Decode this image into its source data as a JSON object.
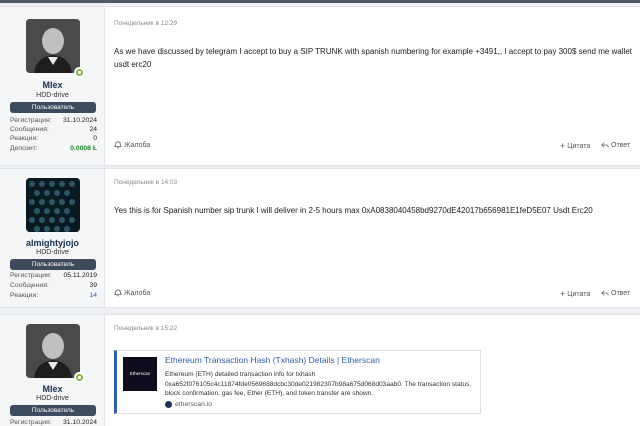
{
  "posts": [
    {
      "user": {
        "name": "Mlex",
        "title": "HDD-drive",
        "badge": "Пользователь",
        "stats": [
          {
            "label": "Регистрация:",
            "value": "31.10.2024"
          },
          {
            "label": "Сообщения:",
            "value": "24"
          },
          {
            "label": "Реакции:",
            "value": "0"
          },
          {
            "label": "Депозит:",
            "value": "0.0008 Ł"
          }
        ]
      },
      "date": "Понедельник в 12:29",
      "message": "As we have discussed by telegram I accept to buy a SIP TRUNK with spanish numbering for example +3491,, I accept to pay 300$ send me wallet usdt erc20",
      "actions": {
        "report": "Жалоба",
        "quote": "Цитата",
        "reply": "Ответ"
      }
    },
    {
      "user": {
        "name": "almightyjojo",
        "title": "HDD-drive",
        "badge": "Пользователь",
        "stats": [
          {
            "label": "Регистрация:",
            "value": "05.11.2019"
          },
          {
            "label": "Сообщения:",
            "value": "39"
          },
          {
            "label": "Реакции:",
            "value": "14"
          }
        ]
      },
      "date": "Понедельник в 14:03",
      "message": "Yes this is for Spanish number sip trunk I will deliver in 2-5 hours max 0xA0838040458bd9270dE42017b656981E1feD5E07 Usdt Erc20",
      "actions": {
        "report": "Жалоба",
        "quote": "Цитата",
        "reply": "Ответ"
      }
    },
    {
      "user": {
        "name": "Mlex",
        "title": "HDD-drive",
        "badge": "Пользователь",
        "stats": [
          {
            "label": "Регистрация:",
            "value": "31.10.2024"
          }
        ]
      },
      "date": "Понедельник в 15:22",
      "embed": {
        "thumb_text": "Etherscan",
        "title": "Ethereum Transaction Hash (Txhash) Details | Etherscan",
        "description": "Ethereum (ETH) detailed transaction info for txhash 0xa652f076105c4c11874fde0569688dcbc30de021982307b98a675d068d03aab0. The transaction status, block confirmation, gas fee, Ether (ETH), and token transfer are shown.",
        "site": "etherscan.io"
      }
    }
  ],
  "colors": {
    "accent": "#2f5fa8",
    "badge_bg": "#3d4b5c",
    "deposit": "#1d8a2a",
    "online": "#7ab83a"
  }
}
